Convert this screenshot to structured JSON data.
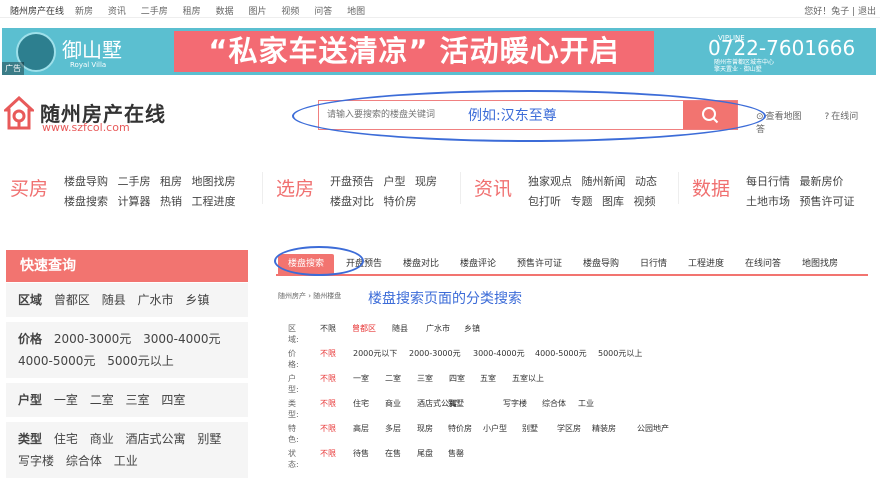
{
  "topbar": {
    "brand": "随州房产在线",
    "nav": [
      "新房",
      "资讯",
      "二手房",
      "租房",
      "数据",
      "图片",
      "视频",
      "问答",
      "地图"
    ],
    "user_greet": "您好！兔子",
    "logout": "退出"
  },
  "banner": {
    "ad_badge": "广告",
    "logo_text": "御山墅",
    "logo_sub": "Royal Villa",
    "slogan": "“私家车送清凉” 活动暖心开启",
    "vip_label": "VIPLINE",
    "phone": "0722-7601666",
    "address_line1": "随州市曾都区城市中心",
    "address_line2": "擎天置业 · 御山墅"
  },
  "site": {
    "name": "随州房产在线",
    "url": "www.szfcol.com"
  },
  "search": {
    "placeholder": "请输入要搜索的楼盘关键词",
    "annotation": "例如:汉东至尊"
  },
  "header_links": {
    "map": "查看地图",
    "qa": "在线问答"
  },
  "categories": [
    {
      "title": "买房",
      "row1": [
        "楼盘导购",
        "二手房",
        "租房",
        "地图找房"
      ],
      "row2": [
        "楼盘搜索",
        "计算器",
        "热销",
        "工程进度"
      ]
    },
    {
      "title": "选房",
      "row1": [
        "开盘预告",
        "户型",
        "现房"
      ],
      "row2": [
        "楼盘对比",
        "特价房"
      ]
    },
    {
      "title": "资讯",
      "row1": [
        "独家观点",
        "随州新闻",
        "动态"
      ],
      "row2": [
        "包打听",
        "专题",
        "图库",
        "视频"
      ]
    },
    {
      "title": "数据",
      "row1": [
        "每日行情",
        "最新房价"
      ],
      "row2": [
        "土地市场",
        "预售许可证"
      ]
    }
  ],
  "sidebar": {
    "title": "快速查询",
    "groups": [
      {
        "label": "区域",
        "items": [
          "曾都区",
          "随县",
          "广水市",
          "乡镇"
        ]
      },
      {
        "label": "价格",
        "items": [
          "2000-3000元",
          "3000-4000元",
          "4000-5000元",
          "5000元以上"
        ]
      },
      {
        "label": "户型",
        "items": [
          "一室",
          "二室",
          "三室",
          "四室"
        ]
      },
      {
        "label": "类型",
        "items": [
          "住宅",
          "商业",
          "酒店式公寓",
          "别墅",
          "写字楼",
          "综合体",
          "工业"
        ]
      }
    ]
  },
  "tabs": [
    "楼盘搜索",
    "开盘预告",
    "楼盘对比",
    "楼盘评论",
    "预售许可证",
    "楼盘导购",
    "日行情",
    "工程进度",
    "在线问答",
    "地图找房"
  ],
  "breadcrumb": "随州房产 › 随州楼盘",
  "page_annotation": "楼盘搜索页面的分类搜索",
  "filters": [
    {
      "label": "区域:",
      "options": [
        "不限",
        "曾都区",
        "随县",
        "广水市",
        "乡镇"
      ],
      "selected": 1
    },
    {
      "label": "价格:",
      "options": [
        "不限",
        "2000元以下",
        "2000-3000元",
        "3000-4000元",
        "4000-5000元",
        "5000元以上"
      ],
      "selected": 0
    },
    {
      "label": "户型:",
      "options": [
        "不限",
        "一室",
        "二室",
        "三室",
        "四室",
        "五室",
        "五室以上"
      ],
      "selected": 0
    },
    {
      "label": "类型:",
      "options": [
        "不限",
        "住宅",
        "商业",
        "酒店式公寓",
        "别墅",
        "写字楼",
        "综合体",
        "工业"
      ],
      "selected": 0
    },
    {
      "label": "特色:",
      "options": [
        "不限",
        "高层",
        "多层",
        "现房",
        "特价房",
        "小户型",
        "别墅",
        "学区房",
        "精装房",
        "公园地产"
      ],
      "selected": 0
    },
    {
      "label": "状态:",
      "options": [
        "不限",
        "待售",
        "在售",
        "尾盘",
        "售罄"
      ],
      "selected": 0
    }
  ],
  "colors": {
    "accent": "#f27470",
    "annotation": "#3c6cd8",
    "selected": "#e83a3a"
  }
}
